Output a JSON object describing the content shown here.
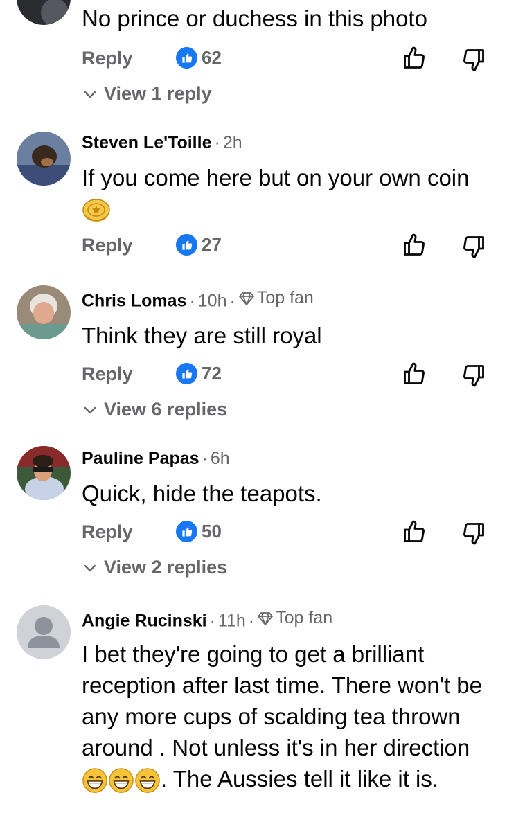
{
  "comments": [
    {
      "author": "",
      "time": "",
      "text": "No prince or duchess in this photo",
      "reply_label": "Reply",
      "likes": "62",
      "view_replies": "View 1 reply"
    },
    {
      "author": "Steven Le'Toille",
      "time": "2h",
      "text": "If you come here but on your own coin",
      "reply_label": "Reply",
      "likes": "27"
    },
    {
      "author": "Chris Lomas",
      "time": "10h",
      "badge": "Top fan",
      "text": "Think they are still royal",
      "reply_label": "Reply",
      "likes": "72",
      "view_replies": "View 6 replies"
    },
    {
      "author": "Pauline Papas",
      "time": "6h",
      "text": "Quick, hide the teapots.",
      "reply_label": "Reply",
      "likes": "50",
      "view_replies": "View 2 replies"
    },
    {
      "author": "Angie Rucinski",
      "time": "11h",
      "badge": "Top fan",
      "text_part1": "I bet they're going to get a brilliant reception after last time. There won't be any more cups of scalding tea thrown around . Not unless it's in her direction",
      "text_part2": ". The Aussies tell it like it is."
    }
  ],
  "icons": {
    "like_badge": "thumbs-up-icon",
    "vote_up": "thumb-up-outline-icon",
    "vote_down": "thumb-down-outline-icon",
    "coin": "coin-emoji",
    "grin": "grinning-emoji",
    "diamond": "diamond-icon"
  },
  "colors": {
    "accent": "#1877f2",
    "muted": "#65676b",
    "text": "#050505"
  }
}
